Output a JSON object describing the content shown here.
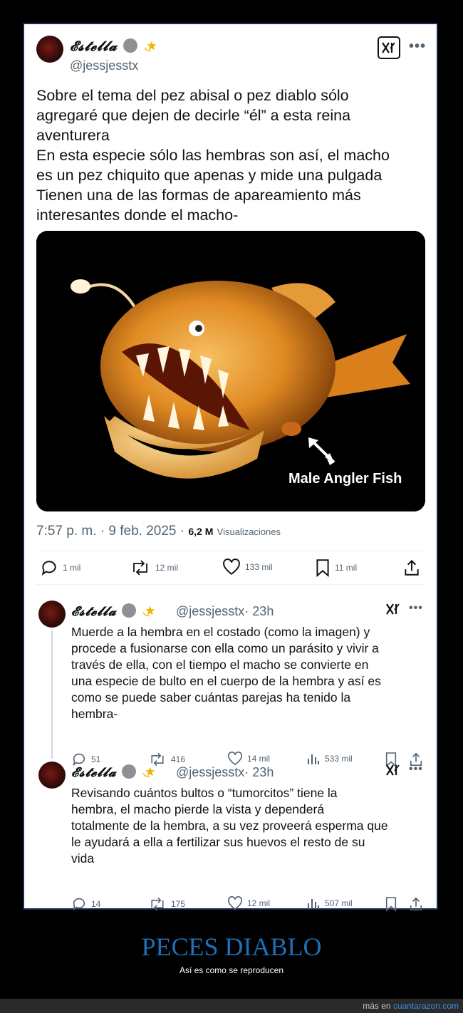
{
  "main_tweet": {
    "display_name": "𝓔𝓼𝓽𝓮𝓵𝓵𝓪",
    "handle": "@jessjesstx",
    "text": "Sobre el tema del pez abisal o pez diablo sólo\nagregaré que dejen de decirle “él”  a esta reina\naventurera\nEn esta especie sólo las hembras son así, el macho\nes un pez chiquito que apenas y mide una pulgada\nTienen una de las formas de apareamiento más\ninteresantes donde el macho-",
    "image_caption": "Male Angler Fish",
    "time": "7:57 p. m. · 9 feb. 2025 · ",
    "views_count": "6,2 M",
    "views_label": "Visualizaciones",
    "actions": {
      "replies": "1 mil",
      "retweets": "12 mil",
      "likes": "133 mil",
      "bookmarks": "11 mil"
    }
  },
  "replies": [
    {
      "display_name": "𝓔𝓼𝓽𝓮𝓵𝓵𝓪",
      "handle": "@jessjesstx",
      "time": "· 23h",
      "text": "Muerde a la hembra en el costado (como la imagen) y\nprocede a fusionarse con ella como un parásito y vivir a\ntravés de ella, con el tiempo el macho se convierte en\nuna especie de bulto en el cuerpo de la hembra y así es\ncomo se puede saber cuántas parejas ha tenido la\nhembra-",
      "replies": "51",
      "retweets": "416",
      "likes": "14 mil",
      "views": "533 mil"
    },
    {
      "display_name": "𝓔𝓼𝓽𝓮𝓵𝓵𝓪",
      "handle": "@jessjesstx",
      "time": "· 23h",
      "text": "Revisando cuántos bultos o “tumorcitos” tiene la\nhembra, el macho pierde la vista y dependerá\ntotalmente de la hembra, a su vez proveerá esperma que\nle ayudará a ella a fertilizar sus huevos el resto de su\nvida",
      "replies": "14",
      "retweets": "175",
      "likes": "12 mil",
      "views": "507 mil"
    }
  ],
  "footer": {
    "title": "PECES DIABLO",
    "subtitle": "Así es como se reproducen",
    "more_prefix": "más en ",
    "more_link": "cuantarazon.com"
  },
  "colors": {
    "footer_title": "#1e6fb5",
    "link": "#3a8fe0",
    "muted": "#536471"
  }
}
